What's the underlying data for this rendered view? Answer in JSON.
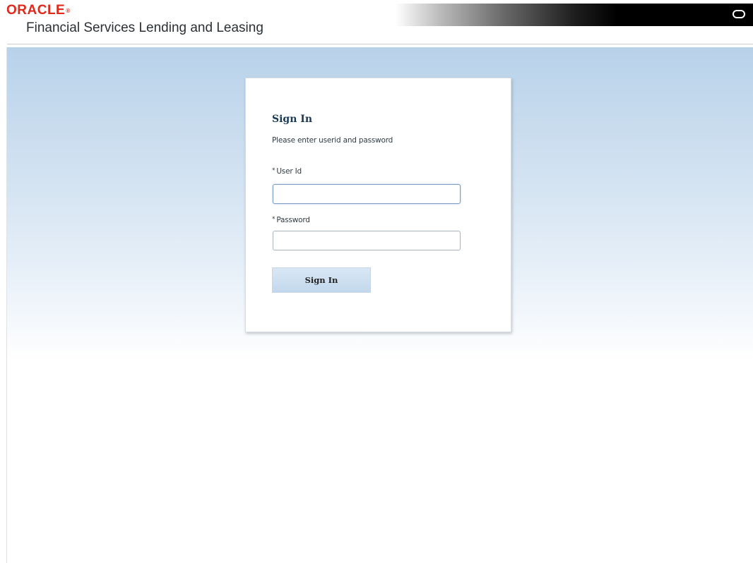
{
  "header": {
    "brand": "ORACLE",
    "brand_mark": "®",
    "product_title": "Financial Services Lending and Leasing",
    "corner_icon": "oracle-o-icon"
  },
  "signin": {
    "heading": "Sign In",
    "hint": "Please enter userid and password",
    "required_marker": "*",
    "userid_label": "User Id",
    "userid_value": "",
    "password_label": "Password",
    "password_value": "",
    "button_label": "Sign In"
  },
  "colors": {
    "brand_red": "#e0281b",
    "panel_bg": "#ffffff",
    "page_gradient_top": "#b8d2ea",
    "button_bg": "#c3d8ed"
  }
}
